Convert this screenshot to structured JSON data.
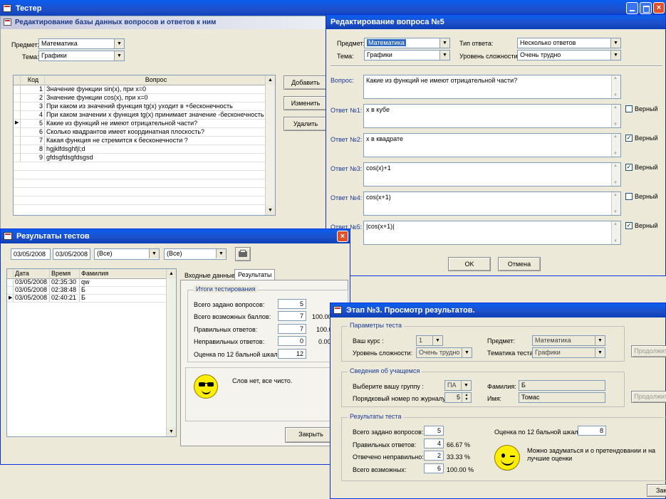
{
  "main_title": "Тестер",
  "editor": {
    "title": "Редактирование базы данных вопросов и ответов к ним",
    "subject_label": "Предмет:",
    "subject_value": "Математика",
    "topic_label": "Тема:",
    "topic_value": "Графики",
    "col_code": "Код",
    "col_question": "Вопрос",
    "rows": [
      {
        "code": "1",
        "q": "Значение функции sin(x), при x=0"
      },
      {
        "code": "2",
        "q": "Значение функции cos(x), при x=0"
      },
      {
        "code": "3",
        "q": "При каком из значений функция tg(x) уходит в +бесконечность"
      },
      {
        "code": "4",
        "q": "При каком значении x функция tg(x) принимает значение -бесконечность"
      },
      {
        "code": "5",
        "q": "Какие из функций не имеют отрицательной части?"
      },
      {
        "code": "6",
        "q": "Сколько квадрантов имеет координатная плоскость?"
      },
      {
        "code": "7",
        "q": "Какая функция не стремится к бесконечности ?"
      },
      {
        "code": "8",
        "q": "hgjklfdsghfjl;d"
      },
      {
        "code": "9",
        "q": "gfdsgfdsgfdsgsd"
      }
    ],
    "btn_add": "Добавить",
    "btn_edit": "Изменить",
    "btn_delete": "Удалить"
  },
  "question_dialog": {
    "title": "Редактирование вопроса №5",
    "subject_label": "Предмет:",
    "subject_value": "Математика",
    "answer_type_label": "Тип ответа:",
    "answer_type_value": "Несколько ответов",
    "topic_label": "Тема:",
    "topic_value": "Графики",
    "difficulty_label": "Уровень сложности:",
    "difficulty_value": "Очень трудно",
    "question_label": "Вопрос:",
    "question_text": "Какие из функций не имеют отрицательной части?",
    "correct_label": "Верный",
    "answers": [
      {
        "label": "Ответ №1:",
        "text": "x в кубе",
        "correct": false
      },
      {
        "label": "Ответ №2:",
        "text": "x в квадрате",
        "correct": true
      },
      {
        "label": "Ответ №3:",
        "text": "cos(x)+1",
        "correct": true
      },
      {
        "label": "Ответ №4:",
        "text": "cos(x+1)",
        "correct": false
      },
      {
        "label": "Ответ №5:",
        "text": "|cos(x+1)|",
        "correct": true
      }
    ],
    "btn_ok": "OK",
    "btn_cancel": "Отмена"
  },
  "results": {
    "title": "Результаты тестов",
    "date_from": "03/05/2008",
    "date_to": "03/05/2008",
    "filter1": "(Все)",
    "filter2": "(Все)",
    "col_date": "Дата",
    "col_time": "Время",
    "col_name": "Фамилия",
    "rows": [
      {
        "date": "03/05/2008",
        "time": "02:35:30",
        "name": "qw"
      },
      {
        "date": "03/05/2008",
        "time": "02:38:48",
        "name": "Б"
      },
      {
        "date": "03/05/2008",
        "time": "02:40:21",
        "name": "Б"
      }
    ],
    "tab_input": "Входные данные",
    "tab_results": "Результаты",
    "summary_caption": "Итоги тестирования",
    "total_q_label": "Всего задано вопросов:",
    "total_q": "5",
    "max_points_label": "Всего возможных баллов:",
    "max_points": "7",
    "max_points_pct": "100.00",
    "correct_label": "Правильных ответов:",
    "correct": "7",
    "correct_pct": "100.0",
    "wrong_label": "Неправильных ответов:",
    "wrong": "0",
    "wrong_pct": "0.00",
    "grade_label": "Оценка по 12 бальной шкале:",
    "grade": "12",
    "comment": "Слов нет, все чисто.",
    "btn_close": "Закрыть"
  },
  "stage3": {
    "title": "Этап №3. Просмотр результатов.",
    "params_caption": "Параметры теста",
    "course_label": "Ваш курс :",
    "course_value": "1",
    "subject_label": "Предмет:",
    "subject_value": "Математика",
    "difficulty_label": "Уровень сложности:",
    "difficulty_value": "Очень трудно",
    "topic_label": "Тематика теста:",
    "topic_value": "Графики",
    "btn_continue1": "Продолжить",
    "student_caption": "Сведения об учащемся",
    "group_label": "Выберите вашу группу :",
    "group_value": "ПА",
    "surname_label": "Фамилия:",
    "surname_value": "Б",
    "number_label": "Порядковый номер по журналу:",
    "number_value": "5",
    "name_label": "Имя:",
    "name_value": "Томас",
    "btn_continue2": "Продолжить",
    "results_caption": "Результаты теста",
    "total_label": "Всего задано вопросов:",
    "total": "5",
    "grade_label": "Оценка по 12 бальной шкале:",
    "grade": "8",
    "correct_label": "Правильных ответов:",
    "correct": "4",
    "correct_pct": "66.67 %",
    "wrong_label": "Отвечено неправильно:",
    "wrong": "2",
    "wrong_pct": "33.33 %",
    "possible_label": "Всего возможных:",
    "possible": "6",
    "possible_pct": "100.00 %",
    "comment": "Можно задуматься и о претендовании и на лучшие оценки",
    "btn_close": "Зак"
  }
}
